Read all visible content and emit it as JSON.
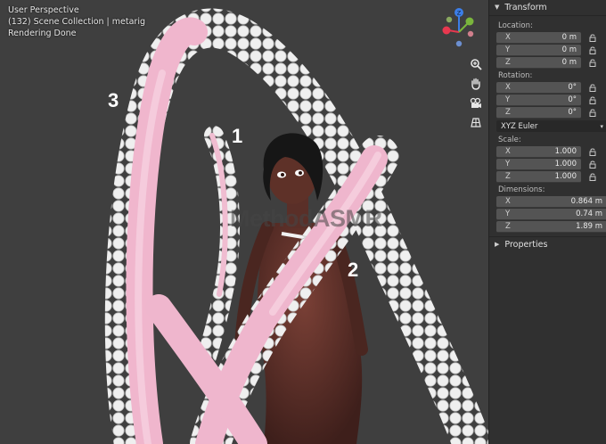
{
  "viewport": {
    "mode": "User Perspective",
    "collection": "(132) Scene Collection | metarig",
    "status": "Rendering Done",
    "watermark": "MethodASMR",
    "annotations": [
      "1",
      "2",
      "3"
    ],
    "gizmo_axes": [
      "X",
      "Y",
      "Z"
    ],
    "tools": [
      "zoom-icon",
      "hand-icon",
      "camera-icon",
      "grid-icon"
    ]
  },
  "panel": {
    "transform_title": "Transform",
    "location_label": "Location:",
    "location": [
      {
        "axis": "X",
        "value": "0 m"
      },
      {
        "axis": "Y",
        "value": "0 m"
      },
      {
        "axis": "Z",
        "value": "0 m"
      }
    ],
    "rotation_label": "Rotation:",
    "rotation": [
      {
        "axis": "X",
        "value": "0°"
      },
      {
        "axis": "Y",
        "value": "0°"
      },
      {
        "axis": "Z",
        "value": "0°"
      }
    ],
    "rotation_mode": "XYZ Euler",
    "scale_label": "Scale:",
    "scale": [
      {
        "axis": "X",
        "value": "1.000"
      },
      {
        "axis": "Y",
        "value": "1.000"
      },
      {
        "axis": "Z",
        "value": "1.000"
      }
    ],
    "dimensions_label": "Dimensions:",
    "dimensions": [
      {
        "axis": "X",
        "value": "0.864 m"
      },
      {
        "axis": "Y",
        "value": "0.74 m"
      },
      {
        "axis": "Z",
        "value": "1.89 m"
      }
    ],
    "properties_title": "Properties"
  },
  "colors": {
    "tentacle_pink": "#efb8cf",
    "sucker_white": "#ececec",
    "skin": "#5a2f28",
    "axis_x": "#e8384f",
    "axis_y": "#7ab53c",
    "axis_z": "#3c7ee8"
  }
}
